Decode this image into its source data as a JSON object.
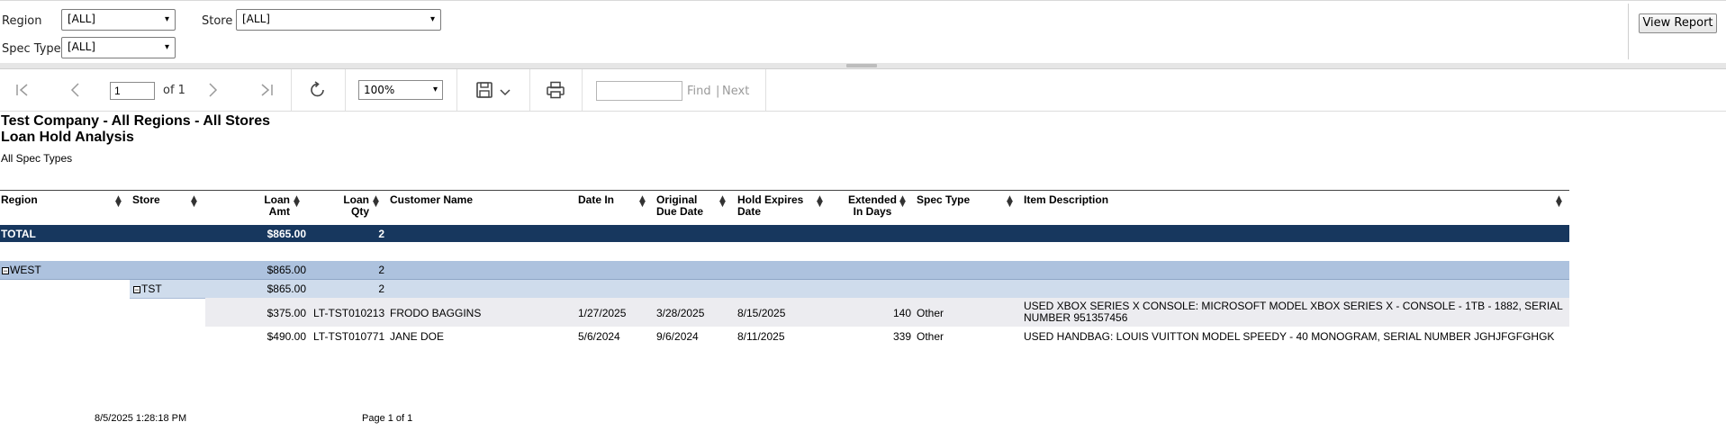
{
  "parameters": {
    "region": {
      "label": "Region",
      "value": "[ALL]"
    },
    "store": {
      "label": "Store",
      "value": "[ALL]"
    },
    "spec_type": {
      "label": "Spec Type",
      "value": "[ALL]"
    },
    "view_report_label": "View Report"
  },
  "toolbar": {
    "page_value": "1",
    "page_of": "of 1",
    "zoom_value": "100%",
    "find_label": "Find",
    "separator": "|",
    "next_label": "Next",
    "icons": [
      "first-page-icon",
      "previous-page-icon",
      "next-page-icon",
      "last-page-icon",
      "refresh-icon",
      "save-icon",
      "chevron-down-icon",
      "print-icon"
    ]
  },
  "report": {
    "title_line1": "Test Company - All Regions - All Stores",
    "title_line2": "Loan Hold Analysis",
    "subtitle": "All Spec Types",
    "columns": {
      "region": "Region",
      "store": "Store",
      "loan_amt_1": "Loan",
      "loan_amt_2": "Amt",
      "loan_qty_1": "Loan",
      "loan_qty_2": "Qty",
      "customer": "Customer Name",
      "date_in": "Date In",
      "orig_due_1": "Original",
      "orig_due_2": "Due Date",
      "hold_exp_1": "Hold Expires",
      "hold_exp_2": "Date",
      "ext_1": "Extended",
      "ext_2": "In Days",
      "spec": "Spec Type",
      "desc": "Item Description"
    },
    "total_row": {
      "label": "TOTAL",
      "amount": "$865.00",
      "qty": "2"
    },
    "region_row": {
      "toggle": "⊟",
      "label": "WEST",
      "amount": "$865.00",
      "qty": "2"
    },
    "store_row": {
      "toggle": "⊟",
      "label": "TST",
      "amount": "$865.00",
      "qty": "2"
    },
    "rows": [
      {
        "amount": "$375.00",
        "loan_no": "LT-TST010213",
        "customer": "FRODO BAGGINS",
        "date_in": "1/27/2025",
        "orig_due": "3/28/2025",
        "hold_exp": "8/15/2025",
        "ext_days": "140",
        "spec": "Other",
        "desc_1": "USED XBOX SERIES X CONSOLE: MICROSOFT MODEL XBOX SERIES X - CONSOLE - 1TB - 1882, SERIAL",
        "desc_2": "NUMBER 951357456"
      },
      {
        "amount": "$490.00",
        "loan_no": "LT-TST010771",
        "customer": "JANE DOE",
        "date_in": "5/6/2024",
        "orig_due": "9/6/2024",
        "hold_exp": "8/11/2025",
        "ext_days": "339",
        "spec": "Other",
        "desc_1": "USED HANDBAG: LOUIS VUITTON MODEL SPEEDY - 40 MONOGRAM, SERIAL NUMBER JGHJFGFGHGK",
        "desc_2": ""
      }
    ],
    "footer": {
      "timestamp": "8/5/2025 1:28:18 PM",
      "page": "Page 1 of 1"
    },
    "colors": {
      "header_dark": "#17375e",
      "region_band": "#adc2de",
      "store_band": "#cfdcec",
      "detail_band": "#ececf0"
    }
  }
}
